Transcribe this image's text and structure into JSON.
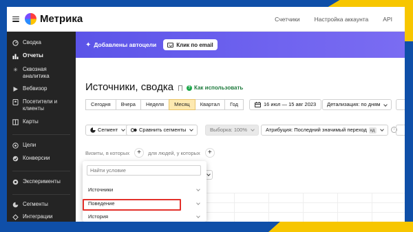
{
  "topbar": {
    "app_title": "Метрика",
    "links": [
      "Счетчики",
      "Настройка аккаунта",
      "API"
    ]
  },
  "sidebar": {
    "items": [
      {
        "label": "Сводка",
        "icon": "dashboard-icon"
      },
      {
        "label": "Отчеты",
        "icon": "reports-icon",
        "active": true
      },
      {
        "label": "Сквозная аналитика",
        "icon": "sparkle-icon"
      },
      {
        "label": "Вебвизор",
        "icon": "play-icon"
      },
      {
        "label": "Посетители и клиенты",
        "icon": "people-icon"
      },
      {
        "label": "Карты",
        "icon": "map-icon"
      },
      {
        "label": "Цели",
        "icon": "target-icon"
      },
      {
        "label": "Конверсии",
        "icon": "conversion-icon"
      },
      {
        "label": "Эксперименты",
        "icon": "experiments-icon"
      },
      {
        "label": "Сегменты",
        "icon": "segments-icon"
      },
      {
        "label": "Интеграции",
        "icon": "integrations-icon"
      }
    ]
  },
  "banner": {
    "text": "Добавлены автоцели",
    "button_label": "Клик по email",
    "color": "#6159ea"
  },
  "report": {
    "title": "Источники, сводка",
    "howto": "Как использовать",
    "periods": [
      "Сегодня",
      "Вчера",
      "Неделя",
      "Месяц",
      "Квартал",
      "Год"
    ],
    "selected_period": "Месяц",
    "date_range": "16 июл — 15 авг 2023",
    "detail": "Детализация: по дням"
  },
  "filters": {
    "segment": "Сегмент",
    "compare": "Сравнить сегменты",
    "sample": "Выборка: 100%",
    "attribution": "Атрибуция: Последний значимый переход",
    "attribution_tag": "кд"
  },
  "visits": {
    "prefix": "Визиты, в которых",
    "mid": "для людей, у которых",
    "plus": "+"
  },
  "popup": {
    "search_placeholder": "Найти условие",
    "items": [
      "Источники",
      "Поведение",
      "История"
    ],
    "highlighted": "Поведение",
    "highlight_color": "#e3302a"
  }
}
